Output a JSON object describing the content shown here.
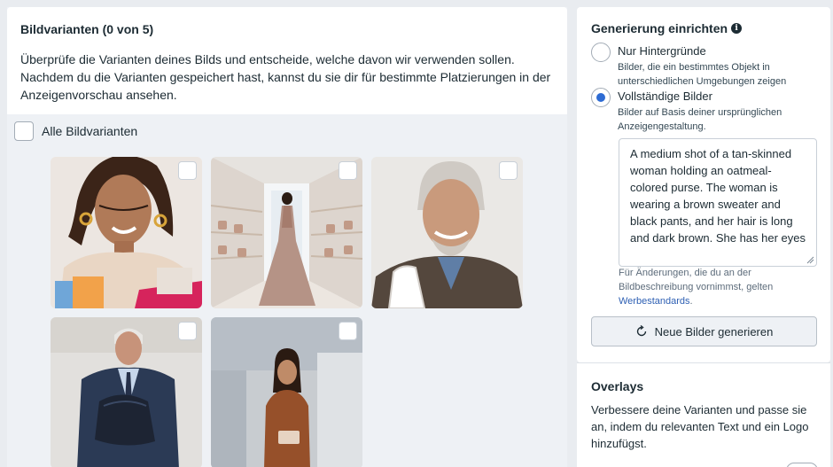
{
  "variants": {
    "title": "Bildvarianten (0 von 5)",
    "description": "Überprüfe die Varianten deines Bilds und entscheide, welche davon wir verwenden sollen. Nachdem du die Varianten gespeichert hast, kannst du sie dir für bestimmte Platzierungen in der Anzeigenvorschau ansehen.",
    "select_all_label": "Alle Bildvarianten",
    "selected_count": 0,
    "total_count": 5
  },
  "generation": {
    "title": "Generierung einrichten",
    "info_glyph": "i",
    "options": [
      {
        "label": "Nur Hintergründe",
        "sublabel": "Bilder, die ein bestimmtes Objekt in unterschiedlichen Umgebungen zeigen",
        "selected": false
      },
      {
        "label": "Vollständige Bilder",
        "sublabel": "Bilder auf Basis deiner ursprünglichen Anzeigengestaltung.",
        "selected": true
      }
    ],
    "prompt_value": "A medium shot of a tan-skinned woman holding an oatmeal-colored purse. The woman is wearing a brown sweater and black pants, and her hair is long and dark brown. She has her eyes",
    "hint_text": "Für Änderungen, die du an der Bildbeschreibung vornimmst, gelten",
    "hint_link": "Werbestandards",
    "hint_end": ".",
    "button_label": "Neue Bilder generieren"
  },
  "overlays": {
    "title": "Overlays",
    "description": "Verbessere deine Varianten und passe sie an, indem du relevanten Text und ein Logo hinzufügst."
  },
  "colors": {
    "accent": "#2d6bd3",
    "link": "#2d5fb3",
    "text": "#1c2b33",
    "panel_bg": "#eef1f5"
  },
  "icons": {
    "info": "info-icon",
    "refresh": "refresh-icon",
    "resize": "resize-handle-icon"
  }
}
